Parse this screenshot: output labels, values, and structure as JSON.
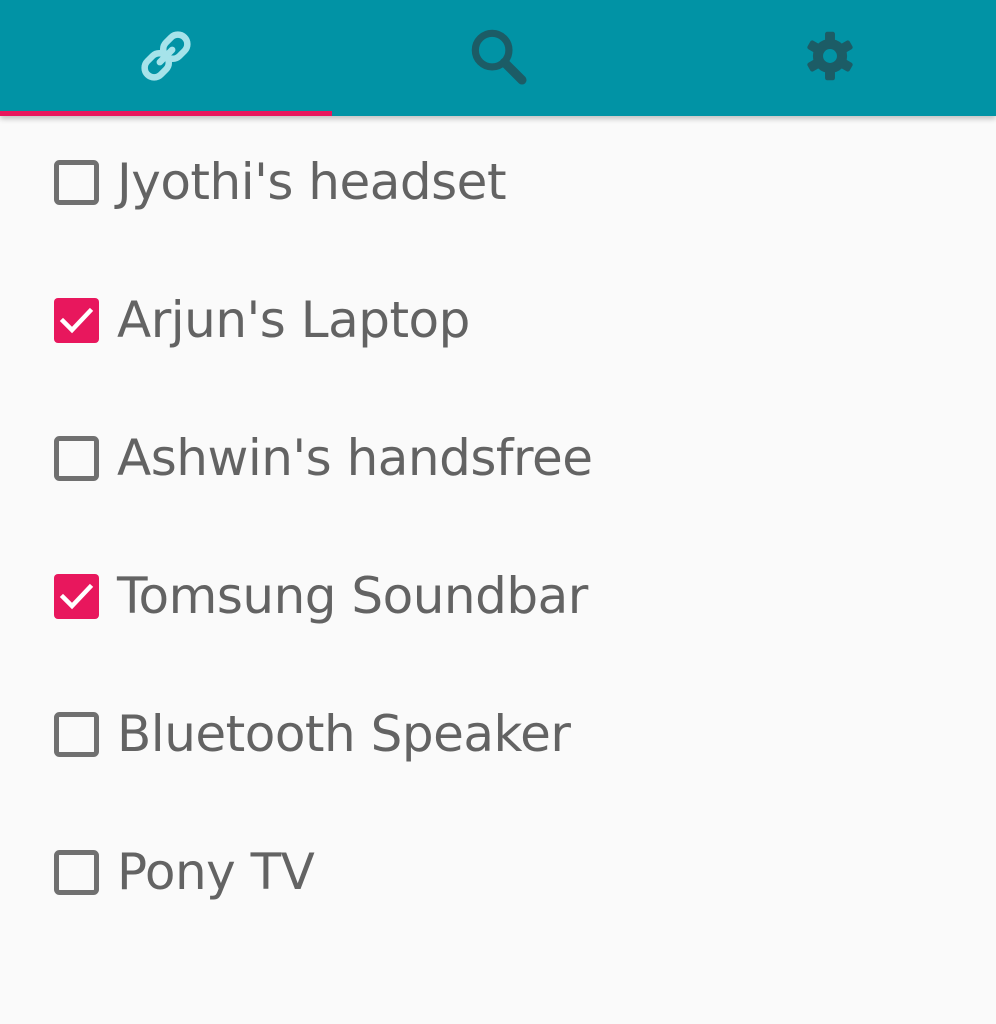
{
  "colors": {
    "toolbar": "#0193a5",
    "accent": "#e8175d",
    "active_icon": "#a6e3ea",
    "inactive_icon": "#1c5c66",
    "checkbox_border": "#707070",
    "label": "#636363"
  },
  "tabs": [
    {
      "icon": "link-icon",
      "active": true
    },
    {
      "icon": "search-icon",
      "active": false
    },
    {
      "icon": "gear-icon",
      "active": false
    }
  ],
  "devices": [
    {
      "label": "Jyothi's headset",
      "checked": false
    },
    {
      "label": "Arjun's Laptop",
      "checked": true
    },
    {
      "label": "Ashwin's handsfree",
      "checked": false
    },
    {
      "label": "Tomsung Soundbar",
      "checked": true
    },
    {
      "label": "Bluetooth Speaker",
      "checked": false
    },
    {
      "label": "Pony TV",
      "checked": false
    }
  ]
}
